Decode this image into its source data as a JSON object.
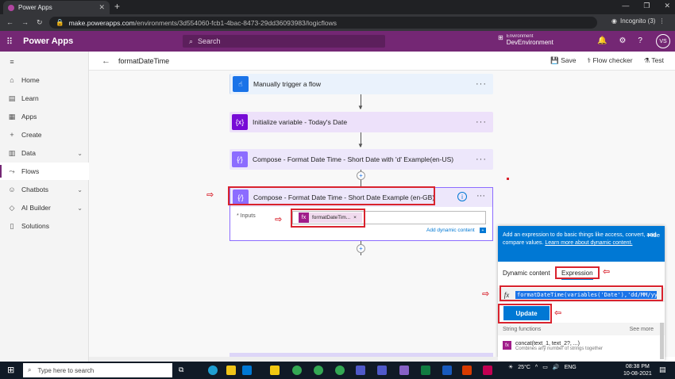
{
  "browser": {
    "tab_title": "Power Apps",
    "url_domain": "make.powerapps.com",
    "url_path": "/environments/3d554060-fcb1-4bac-8473-29dd36093983/logicflows",
    "profile": "Incognito (3)"
  },
  "header": {
    "app_name": "Power Apps",
    "search_placeholder": "Search",
    "environment_label": "Environment",
    "environment_name": "DevEnvironment",
    "avatar_initials": "VS"
  },
  "command_bar": {
    "flow_name": "formatDateTime",
    "save": "Save",
    "flow_checker": "Flow checker",
    "test": "Test"
  },
  "sidebar": {
    "items": [
      {
        "label": "Home"
      },
      {
        "label": "Learn"
      },
      {
        "label": "Apps"
      },
      {
        "label": "Create"
      },
      {
        "label": "Data"
      },
      {
        "label": "Flows"
      },
      {
        "label": "Chatbots"
      },
      {
        "label": "AI Builder"
      },
      {
        "label": "Solutions"
      }
    ]
  },
  "flow": {
    "steps": [
      {
        "title": "Manually trigger a flow",
        "icon": "hand-pointer-icon",
        "color": "#1a73e8"
      },
      {
        "title": "Initialize variable - Today's Date",
        "icon": "variable-icon",
        "color": "#770bd6"
      },
      {
        "title": "Compose - Format Date Time - Short Date with 'd' Example(en-US)",
        "icon": "compose-icon",
        "color": "#8c6cff"
      },
      {
        "title": "Compose - Format Date Time - Short Date Example (en-GB)",
        "icon": "compose-icon",
        "color": "#8c6cff"
      }
    ],
    "inputs_label": "* Inputs",
    "token_label": "formatDateTim...",
    "add_dynamic": "Add dynamic content"
  },
  "expression_panel": {
    "info_text": "Add an expression to do basic things like access, convert, and compare values.",
    "learn_more": "Learn more about dynamic content.",
    "hide": "Hide",
    "tab_dynamic": "Dynamic content",
    "tab_expression": "Expression",
    "expression": "formatDateTime(variables('Date'),'dd/MM/yy",
    "update": "Update",
    "section": "String functions",
    "see_more": "See more",
    "func_name": "concat(text_1, text_2?, ...)",
    "func_desc": "Combines any number of strings together"
  },
  "taskbar": {
    "search_placeholder": "Type here to search",
    "temperature": "25°C",
    "lang": "ENG",
    "time": "08:38 PM",
    "date": "10-08-2021"
  },
  "colors": {
    "brand": "#742774",
    "accent": "#0078d4",
    "highlight": "#d9232e"
  }
}
